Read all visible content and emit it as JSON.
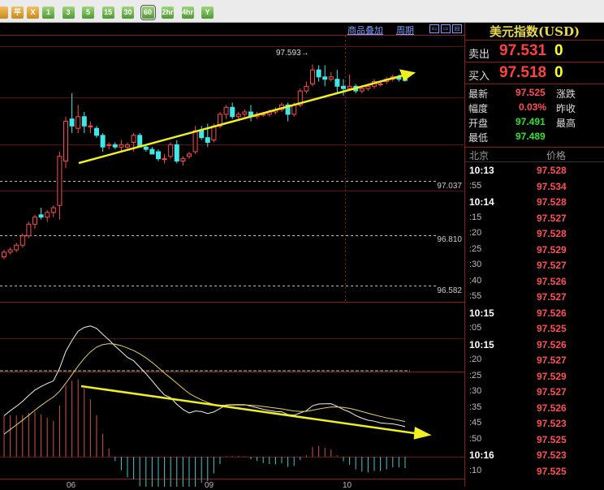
{
  "toolbar": {
    "buttons": [
      {
        "label": "",
        "kind": "o"
      },
      {
        "label": "平",
        "kind": "o"
      },
      {
        "label": "X",
        "kind": "o"
      },
      {
        "label": "1",
        "kind": "g"
      },
      {
        "label": "3",
        "kind": "g"
      },
      {
        "label": "5",
        "kind": "g"
      },
      {
        "label": "15",
        "kind": "g"
      },
      {
        "label": "30",
        "kind": "g"
      },
      {
        "label": "60",
        "kind": "g",
        "selected": true
      },
      {
        "label": "2hr",
        "kind": "g"
      },
      {
        "label": "4hr",
        "kind": "g"
      },
      {
        "label": "Y",
        "kind": "g"
      }
    ]
  },
  "chart": {
    "overlay_link": "商品叠加",
    "period_link": "周期",
    "nav": [
      "⇦",
      "⇨",
      "⊟"
    ],
    "high_marker": "97.593",
    "price_labels": [
      "97.037",
      "96.810",
      "96.582"
    ],
    "x_labels": [
      "06",
      "09",
      "10"
    ]
  },
  "chart_data": {
    "type": "candlestick",
    "series": [
      [
        96.77,
        96.8,
        96.76,
        96.79
      ],
      [
        96.79,
        96.81,
        96.78,
        96.8
      ],
      [
        96.8,
        96.83,
        96.79,
        96.82
      ],
      [
        96.82,
        96.87,
        96.81,
        96.86
      ],
      [
        96.86,
        96.92,
        96.85,
        96.91
      ],
      [
        96.91,
        96.95,
        96.89,
        96.94
      ],
      [
        96.95,
        96.98,
        96.93,
        96.94
      ],
      [
        96.94,
        96.97,
        96.92,
        96.96
      ],
      [
        96.96,
        96.99,
        96.94,
        96.98
      ],
      [
        96.99,
        97.22,
        96.93,
        97.2
      ],
      [
        97.18,
        97.37,
        97.15,
        97.35
      ],
      [
        97.36,
        97.47,
        97.3,
        97.33
      ],
      [
        97.32,
        97.42,
        97.3,
        97.37
      ],
      [
        97.37,
        97.39,
        97.3,
        97.33
      ],
      [
        97.33,
        97.35,
        97.3,
        97.33
      ],
      [
        97.32,
        97.33,
        97.28,
        97.29
      ],
      [
        97.29,
        97.3,
        97.22,
        97.24
      ],
      [
        97.25,
        97.26,
        97.23,
        97.25
      ],
      [
        97.25,
        97.26,
        97.23,
        97.24
      ],
      [
        97.24,
        97.27,
        97.22,
        97.25
      ],
      [
        97.24,
        97.26,
        97.23,
        97.25
      ],
      [
        97.26,
        97.3,
        97.22,
        97.29
      ],
      [
        97.29,
        97.3,
        97.24,
        97.24
      ],
      [
        97.24,
        97.25,
        97.22,
        97.23
      ],
      [
        97.23,
        97.24,
        97.21,
        97.21
      ],
      [
        97.22,
        97.23,
        97.18,
        97.19
      ],
      [
        97.19,
        97.21,
        97.17,
        97.19
      ],
      [
        97.2,
        97.26,
        97.19,
        97.25
      ],
      [
        97.25,
        97.27,
        97.17,
        97.18
      ],
      [
        97.18,
        97.2,
        97.16,
        97.19
      ],
      [
        97.2,
        97.22,
        97.19,
        97.21
      ],
      [
        97.22,
        97.33,
        97.21,
        97.31
      ],
      [
        97.31,
        97.33,
        97.27,
        97.28
      ],
      [
        97.28,
        97.34,
        97.24,
        97.26
      ],
      [
        97.27,
        97.34,
        97.26,
        97.33
      ],
      [
        97.33,
        97.39,
        97.32,
        97.38
      ],
      [
        97.38,
        97.42,
        97.36,
        97.41
      ],
      [
        97.41,
        97.43,
        97.36,
        97.37
      ],
      [
        97.37,
        97.39,
        97.36,
        97.38
      ],
      [
        97.38,
        97.4,
        97.37,
        97.39
      ],
      [
        97.39,
        97.42,
        97.35,
        97.37
      ],
      [
        97.37,
        97.39,
        97.36,
        97.38
      ],
      [
        97.38,
        97.39,
        97.37,
        97.38
      ],
      [
        97.38,
        97.4,
        97.37,
        97.39
      ],
      [
        97.39,
        97.41,
        97.38,
        97.4
      ],
      [
        97.4,
        97.43,
        97.39,
        97.42
      ],
      [
        97.42,
        97.43,
        97.35,
        97.38
      ],
      [
        97.38,
        97.43,
        97.37,
        97.42
      ],
      [
        97.42,
        97.49,
        97.41,
        97.48
      ],
      [
        97.48,
        97.52,
        97.47,
        97.5
      ],
      [
        97.51,
        97.593,
        97.5,
        97.57
      ],
      [
        97.57,
        97.59,
        97.52,
        97.54
      ],
      [
        97.54,
        97.59,
        97.5,
        97.53
      ],
      [
        97.53,
        97.56,
        97.52,
        97.54
      ],
      [
        97.53,
        97.57,
        97.47,
        97.5
      ],
      [
        97.5,
        97.53,
        97.46,
        97.49
      ],
      [
        97.49,
        97.55,
        97.48,
        97.5
      ],
      [
        97.5,
        97.51,
        97.47,
        97.48
      ],
      [
        97.48,
        97.5,
        97.47,
        97.49
      ],
      [
        97.49,
        97.51,
        97.48,
        97.5
      ],
      [
        97.5,
        97.53,
        97.49,
        97.52
      ],
      [
        97.51,
        97.52,
        97.5,
        97.51
      ],
      [
        97.52,
        97.54,
        97.51,
        97.53
      ],
      [
        97.53,
        97.55,
        97.52,
        97.54
      ],
      [
        97.54,
        97.55,
        97.52,
        97.53
      ],
      [
        97.53,
        97.54,
        97.52,
        97.525
      ]
    ],
    "ylim": [
      96.55,
      97.64
    ],
    "indicator": "MACD"
  },
  "panel": {
    "title": "美元指数(USD)",
    "sell": {
      "label": "卖出",
      "price": "97.531",
      "qty": "0"
    },
    "buy": {
      "label": "买入",
      "price": "97.518",
      "qty": "0"
    },
    "stats": {
      "latest_label": "最新",
      "latest": "97.525",
      "change_label": "涨跌",
      "amp_label": "幅度",
      "amp": "0.03%",
      "prev_label": "昨收",
      "open_label": "开盘",
      "open": "97.491",
      "high_label": "最高",
      "low_label": "最低",
      "low": "97.489"
    },
    "head": {
      "time": "北京",
      "price": "价格"
    },
    "ticks": [
      {
        "t": "10:13",
        "p": "97.528",
        "b": true
      },
      {
        "t": ":55",
        "p": "97.534"
      },
      {
        "t": "10:14",
        "p": "97.528",
        "b": true
      },
      {
        "t": ":15",
        "p": "97.527"
      },
      {
        "t": ":20",
        "p": "97.528"
      },
      {
        "t": ":25",
        "p": "97.529"
      },
      {
        "t": ":30",
        "p": "97.527"
      },
      {
        "t": ":40",
        "p": "97.526"
      },
      {
        "t": ":55",
        "p": "97.527"
      },
      {
        "t": "10:15",
        "p": "97.526",
        "b": true
      },
      {
        "t": ":05",
        "p": "97.525"
      },
      {
        "t": "10:15",
        "p": "97.526",
        "b": true
      },
      {
        "t": ":20",
        "p": "97.527"
      },
      {
        "t": ":25",
        "p": "97.529"
      },
      {
        "t": ":30",
        "p": "97.527"
      },
      {
        "t": ":35",
        "p": "97.526"
      },
      {
        "t": ":45",
        "p": "97.523"
      },
      {
        "t": ":50",
        "p": "97.525"
      },
      {
        "t": "10:16",
        "p": "97.523",
        "b": true
      },
      {
        "t": ":10",
        "p": "97.525"
      }
    ]
  }
}
